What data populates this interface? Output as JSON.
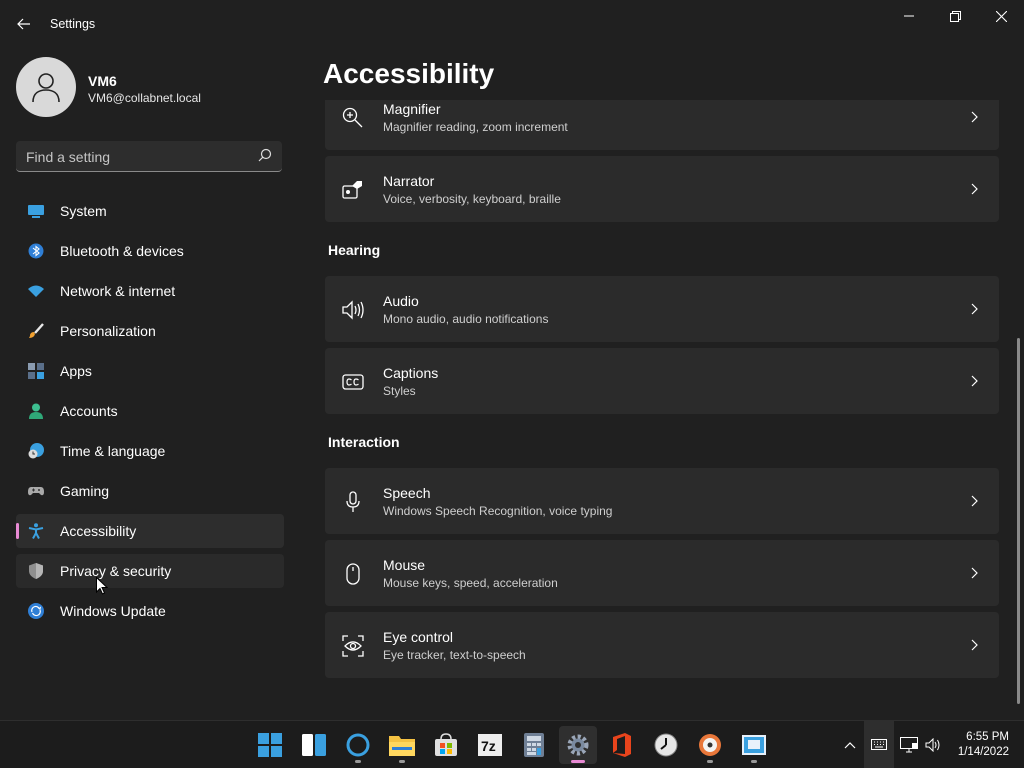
{
  "window": {
    "title": "Settings"
  },
  "user": {
    "name": "VM6",
    "email": "VM6@collabnet.local"
  },
  "search": {
    "placeholder": "Find a setting"
  },
  "nav": {
    "items": [
      {
        "label": "System",
        "icon": "system-icon"
      },
      {
        "label": "Bluetooth & devices",
        "icon": "bluetooth-icon"
      },
      {
        "label": "Network & internet",
        "icon": "wifi-icon"
      },
      {
        "label": "Personalization",
        "icon": "brush-icon"
      },
      {
        "label": "Apps",
        "icon": "apps-icon"
      },
      {
        "label": "Accounts",
        "icon": "person-icon"
      },
      {
        "label": "Time & language",
        "icon": "clock-globe-icon"
      },
      {
        "label": "Gaming",
        "icon": "gamepad-icon"
      },
      {
        "label": "Accessibility",
        "icon": "accessibility-icon",
        "selected": true
      },
      {
        "label": "Privacy & security",
        "icon": "shield-icon"
      },
      {
        "label": "Windows Update",
        "icon": "update-icon"
      }
    ]
  },
  "page": {
    "title": "Accessibility"
  },
  "cards": {
    "magnifier": {
      "title": "Magnifier",
      "subtitle": "Magnifier reading, zoom increment"
    },
    "narrator": {
      "title": "Narrator",
      "subtitle": "Voice, verbosity, keyboard, braille"
    },
    "audio": {
      "title": "Audio",
      "subtitle": "Mono audio, audio notifications"
    },
    "captions": {
      "title": "Captions",
      "subtitle": "Styles"
    },
    "speech": {
      "title": "Speech",
      "subtitle": "Windows Speech Recognition, voice typing"
    },
    "mouse": {
      "title": "Mouse",
      "subtitle": "Mouse keys, speed, acceleration"
    },
    "eye_control": {
      "title": "Eye control",
      "subtitle": "Eye tracker, text-to-speech"
    }
  },
  "sections": {
    "hearing": "Hearing",
    "interaction": "Interaction"
  },
  "taskbar": {
    "apps": [
      "start",
      "task-view",
      "cortana",
      "file-explorer",
      "microsoft-store",
      "7-zip",
      "calculator",
      "settings",
      "office",
      "clock",
      "media-player",
      "remote-desktop"
    ],
    "active_app": "settings",
    "clock": {
      "time": "6:55 PM",
      "date": "1/14/2022"
    }
  },
  "colors": {
    "background": "#202020",
    "card": "#2b2b2b",
    "accent": "#e88ad4",
    "taskbar": "#1c1c1c"
  }
}
